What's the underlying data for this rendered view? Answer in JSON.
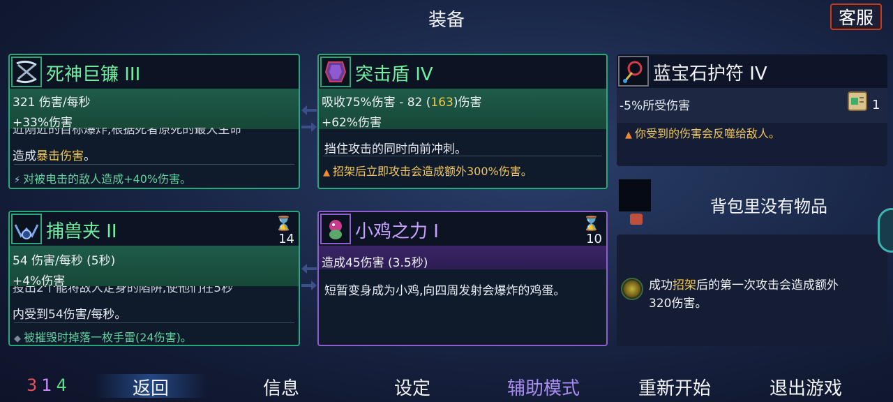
{
  "header": {
    "title": "装备",
    "service_label": "客服"
  },
  "cards": {
    "scythe": {
      "name": "死神巨镰 III",
      "stat1": "321 伤害/每秒",
      "stat2": "+33%伤害",
      "desc_partial": "近刚近的目标爆炸,根据死者原死的最大生命",
      "desc_line2_pre": "造成",
      "desc_line2_hl": "暴击伤害",
      "desc_line2_post": "。",
      "perk": "对被电击的敌人造成+40%伤害。",
      "perk_icon": "lightning-icon"
    },
    "shield": {
      "name": "突击盾 IV",
      "stat1_pre": "吸收75%伤害 - 82 (",
      "stat1_hl": "163",
      "stat1_post": ")伤害",
      "stat2": "+62%伤害",
      "desc": "挡住攻击的同时向前冲刺。",
      "perk": "招架后立即攻击会造成额外300%伤害。",
      "perk_icon": "flame-icon"
    },
    "trap": {
      "name": "捕兽夹 II",
      "timer": "14",
      "stat1": "54 伤害/每秒 (5秒)",
      "stat2": "+4%伤害",
      "desc_partial": "投出2个能将敌人定身的陷阱,使他们在5秒",
      "desc_line2": "内受到54伤害/每秒。",
      "perk": "被摧毁时掉落一枚手雷(24伤害)。",
      "perk_icon": "diamond-icon"
    },
    "chicken": {
      "name": "小鸡之力 I",
      "timer": "10",
      "stat1": "造成45伤害 (3.5秒)",
      "desc": "短暂变身成为小鸡,向四周发射会爆炸的鸡蛋。"
    }
  },
  "amulet": {
    "name": "蓝宝石护符 IV",
    "stat": "-5%所受伤害",
    "scroll_count": "1",
    "perk": "你受到的伤害会反噬给敌人。"
  },
  "backpack": {
    "empty_text": "背包里没有物品"
  },
  "passive": {
    "text_pre": "成功",
    "text_hl": "招架",
    "text_post": "后的第一次攻击会造成额外",
    "text_line2": "320伤害。"
  },
  "bottom": {
    "counter": [
      "3",
      "1",
      "4"
    ],
    "counter_colors": [
      "#e8505a",
      "#c58af5",
      "#5fe08a"
    ],
    "nav": [
      "返回",
      "信息",
      "设定",
      "辅助模式",
      "重新开始",
      "退出游戏"
    ],
    "assist_color": "#a88cf0"
  }
}
